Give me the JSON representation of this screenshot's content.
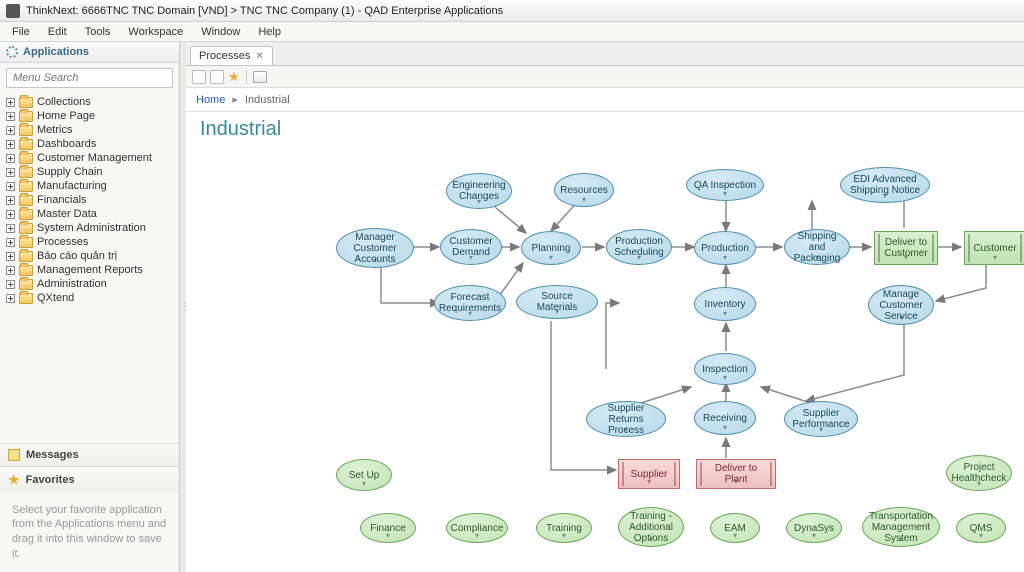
{
  "window_title": "ThinkNext: 6666TNC TNC Domain [VND] > TNC TNC Company (1) - QAD Enterprise Applications",
  "menu": [
    "File",
    "Edit",
    "Tools",
    "Workspace",
    "Window",
    "Help"
  ],
  "sidebar": {
    "header": "Applications",
    "search_placeholder": "Menu Search",
    "items": [
      "Collections",
      "Home Page",
      "Metrics",
      "Dashboards",
      "Customer Management",
      "Supply Chain",
      "Manufacturing",
      "Financials",
      "Master Data",
      "System Administration",
      "Processes",
      "Báo cáo quản trị",
      "Management Reports",
      "Administration",
      "QXtend"
    ],
    "messages": "Messages",
    "favorites": "Favorites",
    "favorites_hint": "Select your favorite application from the Applications menu and drag it into this window to save it."
  },
  "tab": {
    "label": "Processes"
  },
  "breadcrumb": {
    "home": "Home",
    "current": "Industrial"
  },
  "page_title": "Industrial",
  "nodes": {
    "mgr_cust_acc": "Manager\nCustomer\nAccounts",
    "eng_changes": "Engineering\nChanges",
    "resources": "Resources",
    "qa_insp": "QA Inspection",
    "edi": "EDI Advanced\nShipping Notice",
    "cust_demand": "Customer\nDemand",
    "planning": "Planning",
    "prod_sched": "Production\nScheduling",
    "production": "Production",
    "ship_pack": "Shipping and\nPackaging",
    "deliver_cust": "Deliver to\nCustomer",
    "customer": "Customer",
    "forecast": "Forecast\nRequirements",
    "src_mat": "Source Materials",
    "inventory": "Inventory",
    "mng_cust_svc": "Manage\nCustomer\nService",
    "inspection": "Inspection",
    "sup_ret": "Supplier\nReturns Process",
    "receiving": "Receiving",
    "sup_perf": "Supplier\nPerformance",
    "supplier": "Supplier",
    "deliver_plant": "Deliver to Plant",
    "setup": "Set Up",
    "proj_health": "Project\nHealthcheck",
    "finance": "Finance",
    "compliance": "Compliance",
    "training": "Training",
    "training_addl": "Training -\nAdditional\nOptions",
    "eam": "EAM",
    "dynasys": "DynaSys",
    "tms": "Transportation\nManagement\nSystem",
    "qms": "QMS"
  }
}
